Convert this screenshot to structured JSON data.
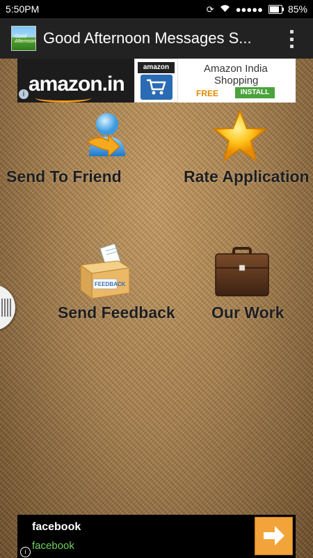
{
  "status_bar": {
    "time": "5:50PM",
    "battery": "85%",
    "battery_level": 0.85
  },
  "action_bar": {
    "title": "Good Afternoon Messages S..."
  },
  "ad_top": {
    "brand": "amazon.in",
    "icon_label": "amazon",
    "title_line1": "Amazon India",
    "title_line2": "Shopping",
    "price": "FREE",
    "install_label": "INSTALL"
  },
  "menu": {
    "items": [
      {
        "label": "Send To Friend",
        "icon": "user-share-icon"
      },
      {
        "label": "Rate Application",
        "icon": "star-icon"
      },
      {
        "label": "Send Feedback",
        "icon": "feedback-box-icon"
      },
      {
        "label": "Our Work",
        "icon": "briefcase-icon"
      }
    ]
  },
  "ad_bottom": {
    "title": "facebook",
    "subtitle": "facebook"
  },
  "colors": {
    "status_bar": "#000000",
    "action_bar": "#222222",
    "label": "#1e1e1e",
    "install_green": "#4aa33b",
    "free_orange": "#e08a00",
    "fb_green": "#6fd15c",
    "arrow_orange": "#f2a33a"
  }
}
